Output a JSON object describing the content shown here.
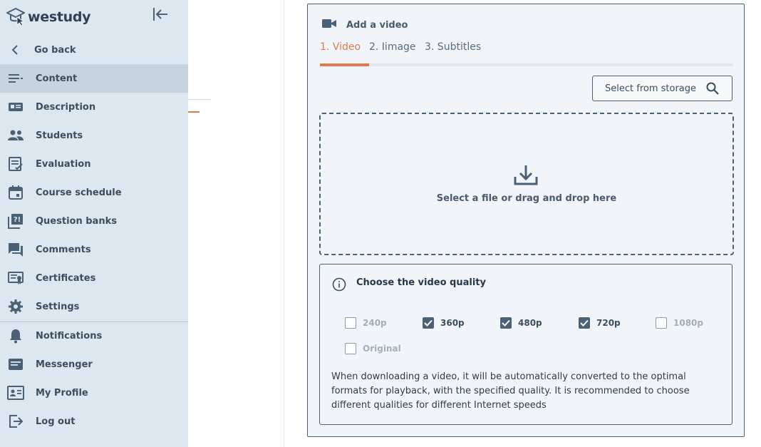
{
  "app": {
    "logo_text": "westudy"
  },
  "sidebar": {
    "items": [
      {
        "label": "Go back",
        "icon": "chevron-left-icon"
      },
      {
        "label": "Content",
        "icon": "list-icon",
        "active": true
      },
      {
        "label": "Description",
        "icon": "id-card-icon"
      },
      {
        "label": "Students",
        "icon": "people-icon"
      },
      {
        "label": "Evaluation",
        "icon": "checklist-icon"
      },
      {
        "label": "Course schedule",
        "icon": "calendar-icon"
      },
      {
        "label": "Question banks",
        "icon": "question-bank-icon"
      },
      {
        "label": "Comments",
        "icon": "comment-icon"
      },
      {
        "label": "Certificates",
        "icon": "certificate-icon"
      },
      {
        "label": "Settings",
        "icon": "gear-icon"
      },
      {
        "label": "Notifications",
        "icon": "bell-icon"
      },
      {
        "label": "Messenger",
        "icon": "message-icon"
      },
      {
        "label": "My Profile",
        "icon": "profile-icon"
      },
      {
        "label": "Log out",
        "icon": "logout-icon"
      }
    ]
  },
  "panel": {
    "title": "Add a video",
    "tabs": [
      {
        "label": "1. Video",
        "active": true
      },
      {
        "label": "2. Iimage",
        "active": false
      },
      {
        "label": "3. Subtitles",
        "active": false
      }
    ],
    "storage_button": "Select from storage",
    "dropzone_text": "Select a file or drag and drop here",
    "quality": {
      "title": "Choose the video quality",
      "options": [
        {
          "label": "240p",
          "checked": false
        },
        {
          "label": "360p",
          "checked": true
        },
        {
          "label": "480p",
          "checked": true
        },
        {
          "label": "720p",
          "checked": true
        },
        {
          "label": "1080p",
          "checked": false
        },
        {
          "label": "Original",
          "checked": false
        }
      ],
      "description": "When downloading a video, it will be automatically converted to the optimal formats for playback, with the specified quality. It is recommended to choose different qualities for different Internet speeds"
    }
  },
  "colors": {
    "accent": "#e07a4a",
    "sidebar_bg": "#dce7ef",
    "sidebar_active": "#c6d4df",
    "dark": "#4b5f75",
    "panel_bg": "#f1f5f9"
  }
}
